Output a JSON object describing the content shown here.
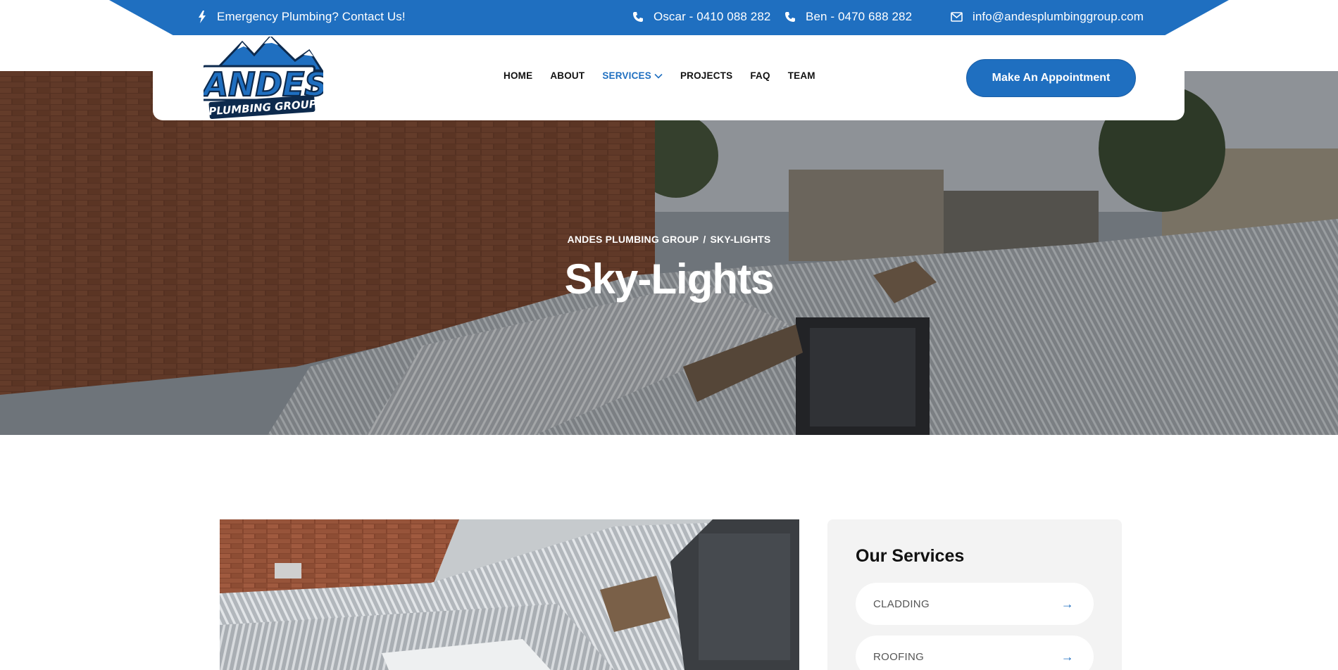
{
  "topbar": {
    "emergency": "Emergency Plumbing? Contact Us!",
    "phone_1": "Oscar - 0410 088 282",
    "phone_2": "Ben - 0470 688 282",
    "email": "info@andesplumbinggroup.com"
  },
  "logo": {
    "line1": "ANDES",
    "line2": "PLUMBING GROUP"
  },
  "nav": {
    "items": [
      "HOME",
      "ABOUT",
      "SERVICES",
      "PROJECTS",
      "FAQ",
      "TEAM"
    ],
    "active": "SERVICES"
  },
  "cta": {
    "label": "Make An Appointment"
  },
  "hero": {
    "breadcrumb": [
      "ANDES PLUMBING GROUP",
      "SKY-LIGHTS"
    ],
    "breadcrumb_separator": "/",
    "title": "Sky-Lights"
  },
  "sidebar": {
    "title": "Our Services",
    "services": [
      "CLADDING",
      "ROOFING"
    ]
  },
  "colors": {
    "brand_blue": "#1f6fc0",
    "sidebar_bg": "#f3f3f3"
  }
}
